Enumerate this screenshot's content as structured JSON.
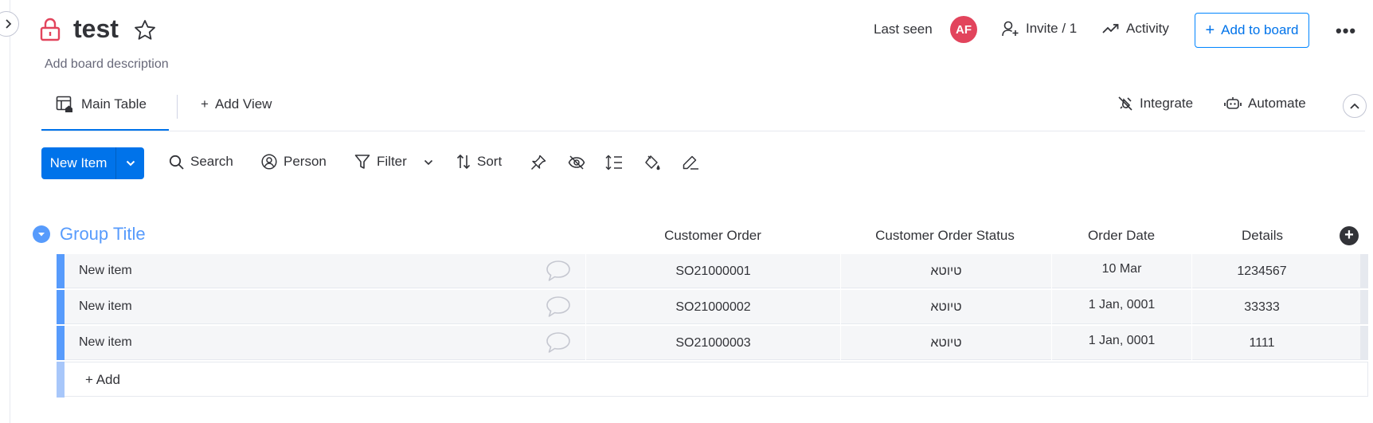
{
  "board": {
    "title": "test",
    "description_placeholder": "Add board description",
    "last_seen_label": "Last seen",
    "avatar_initials": "AF",
    "invite_label": "Invite / 1",
    "activity_label": "Activity",
    "add_to_board_label": "Add to board"
  },
  "views": {
    "main_table_label": "Main Table",
    "add_view_label": "Add View",
    "integrate_label": "Integrate",
    "automate_label": "Automate"
  },
  "toolbar": {
    "new_item_label": "New Item",
    "search_label": "Search",
    "person_label": "Person",
    "filter_label": "Filter",
    "sort_label": "Sort"
  },
  "group": {
    "title": "Group Title",
    "color": "#579bfc",
    "columns": [
      "Customer Order",
      "Customer Order Status",
      "Order Date",
      "Details"
    ],
    "rows": [
      {
        "name": "New item",
        "customer_order": "SO21000001",
        "status": "טיוטא",
        "order_date": "10 Mar",
        "details": "1234567"
      },
      {
        "name": "New item",
        "customer_order": "SO21000002",
        "status": "טיוטא",
        "order_date": "1 Jan, 0001",
        "details": "33333"
      },
      {
        "name": "New item",
        "customer_order": "SO21000003",
        "status": "טיוטא",
        "order_date": "1 Jan, 0001",
        "details": "1111"
      }
    ],
    "add_item_label": "+ Add"
  },
  "colors": {
    "primary": "#0073ea",
    "avatar": "#e2445c",
    "lock": "#e2445c"
  }
}
